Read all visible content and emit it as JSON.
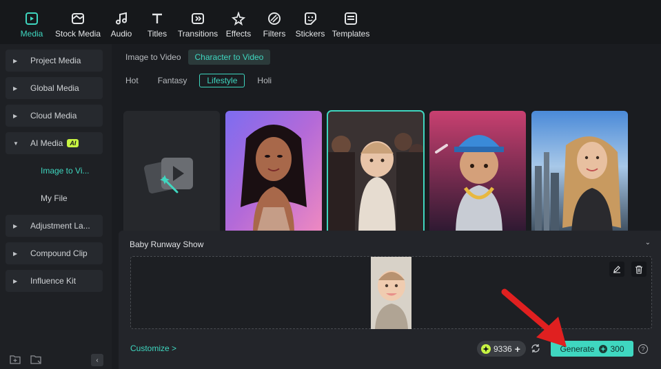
{
  "toolbar": {
    "items": [
      {
        "label": "Media",
        "icon": "media-icon",
        "active": true
      },
      {
        "label": "Stock Media",
        "icon": "stock-media-icon"
      },
      {
        "label": "Audio",
        "icon": "audio-icon"
      },
      {
        "label": "Titles",
        "icon": "titles-icon"
      },
      {
        "label": "Transitions",
        "icon": "transitions-icon"
      },
      {
        "label": "Effects",
        "icon": "effects-icon"
      },
      {
        "label": "Filters",
        "icon": "filters-icon"
      },
      {
        "label": "Stickers",
        "icon": "stickers-icon"
      },
      {
        "label": "Templates",
        "icon": "templates-icon"
      }
    ]
  },
  "sidebar": {
    "items": [
      {
        "label": "Project Media"
      },
      {
        "label": "Global Media"
      },
      {
        "label": "Cloud Media"
      },
      {
        "label": "AI Media",
        "badge": "AI",
        "expanded": true
      },
      {
        "label": "Adjustment La..."
      },
      {
        "label": "Compound Clip"
      },
      {
        "label": "Influence Kit"
      }
    ],
    "sub_items": [
      {
        "label": "Image to Vi...",
        "active": true
      },
      {
        "label": "My File"
      }
    ]
  },
  "main": {
    "mode_tabs": [
      {
        "label": "Image to Video"
      },
      {
        "label": "Character to Video",
        "active": true
      }
    ],
    "category_tabs": [
      {
        "label": "Hot"
      },
      {
        "label": "Fantasy"
      },
      {
        "label": "Lifestyle",
        "active": true
      },
      {
        "label": "Holi"
      }
    ]
  },
  "panel": {
    "title": "Baby Runway Show",
    "customize_label": "Customize >",
    "credits_value": "9336",
    "generate_label": "Generate",
    "generate_cost": "300",
    "help_label": "?"
  },
  "colors": {
    "accent": "#3fd7c0",
    "ai_badge": "#c8f542",
    "annotation_arrow": "#e02020"
  }
}
